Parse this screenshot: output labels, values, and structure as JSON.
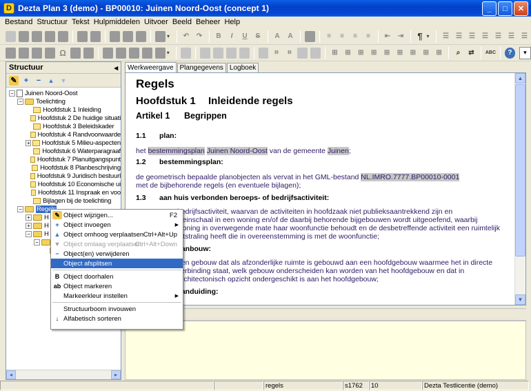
{
  "window": {
    "title": "Dezta Plan 3 (demo) - BP00010: Juinen Noord-Oost (concept 1)",
    "icon_letter": "D",
    "minimize_glyph": "_",
    "maximize_glyph": "□",
    "close_glyph": "✕"
  },
  "menubar": [
    "Bestand",
    "Structuur",
    "Tekst",
    "Hulpmiddelen",
    "Uitvoer",
    "Beeld",
    "Beheer",
    "Help"
  ],
  "toolbar": {
    "paragraph_glyph": "¶",
    "bold": "B",
    "italic": "I",
    "underline": "U",
    "strike": "S",
    "search_glyph": "🔍",
    "spell": "ABC",
    "help_glyph": "?",
    "dropdown_glyph": "▾"
  },
  "structure_panel": {
    "title": "Structuur",
    "collapse_glyph": "◂",
    "tools": {
      "edit": "✎",
      "add": "+",
      "remove": "−",
      "up": "▲",
      "down": "▼"
    },
    "tree": [
      {
        "label": "Juinen Noord-Oost",
        "level": 0,
        "expander": "−",
        "icon": "doc"
      },
      {
        "label": "Toelichting",
        "level": 1,
        "expander": "−",
        "icon": "folder"
      },
      {
        "label": "Hoofdstuk 1 Inleiding",
        "level": 2,
        "expander": "",
        "icon": "page"
      },
      {
        "label": "Hoofdstuk 2 De huidige situati",
        "level": 2,
        "expander": "",
        "icon": "page"
      },
      {
        "label": "Hoofdstuk 3 Beleidskader",
        "level": 2,
        "expander": "",
        "icon": "page"
      },
      {
        "label": "Hoofdstuk 4 Randvoorwaarde",
        "level": 2,
        "expander": "",
        "icon": "page"
      },
      {
        "label": "Hoofdstuk 5 Milieu-aspecten",
        "level": 2,
        "expander": "+",
        "icon": "page"
      },
      {
        "label": "Hoofdstuk 6 Waterparagraaf",
        "level": 2,
        "expander": "",
        "icon": "page"
      },
      {
        "label": "Hoofdstuk 7 Planuitgangspunt",
        "level": 2,
        "expander": "",
        "icon": "page"
      },
      {
        "label": "Hoofdstuk 8 Planbeschrijving",
        "level": 2,
        "expander": "",
        "icon": "page"
      },
      {
        "label": "Hoofdstuk 9 Juridisch bestuurl",
        "level": 2,
        "expander": "",
        "icon": "page"
      },
      {
        "label": "Hoofdstuk 10 Economische ui",
        "level": 2,
        "expander": "",
        "icon": "page"
      },
      {
        "label": "Hoofdstuk 11 Inspraak en voo",
        "level": 2,
        "expander": "",
        "icon": "page"
      },
      {
        "label": "Bijlagen bij de toelichting",
        "level": 2,
        "expander": "",
        "icon": "page"
      },
      {
        "label": "Regels",
        "level": 1,
        "expander": "−",
        "icon": "folder",
        "selected": true
      },
      {
        "label": "H",
        "level": 2,
        "expander": "+",
        "icon": "folder"
      },
      {
        "label": "H",
        "level": 2,
        "expander": "+",
        "icon": "folder"
      },
      {
        "label": "H",
        "level": 2,
        "expander": "−",
        "icon": "folder"
      },
      {
        "label": "",
        "level": 3,
        "expander": "−",
        "icon": "folder"
      },
      {
        "label": "",
        "level": 4,
        "expander": "",
        "icon": "page"
      }
    ],
    "scroll_left": "◂",
    "scroll_right": "▸"
  },
  "tabs": [
    "Werkweergave",
    "Plangegevens",
    "Logboek"
  ],
  "document": {
    "heading": "Regels",
    "chapter_num": "Hoofdstuk 1",
    "chapter_title": "Inleidende regels",
    "article_num": "Artikel 1",
    "article_title": "Begrippen",
    "def1_num": "1.1",
    "def1_title": "plan:",
    "def1_a": "het ",
    "def1_b": "bestemmingsplan",
    "def1_c": " ",
    "def1_d": "Juinen Noord-Oost",
    "def1_e": " van de gemeente ",
    "def1_f": "Juinen",
    "def1_g": ";",
    "def2_num": "1.2",
    "def2_title": "bestemmingsplan:",
    "def2_a": "de geometrisch bepaalde planobjecten als vervat in het GML-bestand ",
    "def2_b": "NL.IMRO.7777.BP00010-0001",
    "def2_c": "met de bijbehorende regels (en eventuele bijlagen);",
    "def3_num": "1.3",
    "def3_title": "aan huis verbonden beroeps- of bedrijfsactiviteit:",
    "def3_l1": "bedrijfsactiviteit, waarvan de activiteiten in hoofdzaak niet publieksaantrekkend zijn en",
    "def3_l2": "kleinschaal in een woning en/of de daarbij behorende bijgebouwen wordt uitgeoefend, waarbij",
    "def3_l3": "woning in overwegende mate haar woonfunctie behoudt en de desbetreffende activiteit een ruimtelijk",
    "def3_l4": "uitstraling heeft die in overeenstemming is met de woonfunctie;",
    "def4_title": "aanbouw:",
    "def4_l1": "een gebouw dat als afzonderlijke ruimte is gebouwd aan een hoofdgebouw waarmee het in directe",
    "def4_l2": "verbinding staat, welk gebouw onderscheiden kan worden van het hoofdgebouw en dat in",
    "def4_l3": "architectonisch opzicht ondergeschikt is aan het hoofdgebouw;",
    "def5_title": "aanduiding:"
  },
  "context_menu": [
    {
      "label": "Object wijzigen...",
      "shortcut": "F2",
      "icon": "✎",
      "disabled": false,
      "submenu": false
    },
    {
      "label": "Object invoegen",
      "shortcut": "",
      "icon": "+",
      "disabled": false,
      "submenu": true
    },
    {
      "label": "Object omhoog verplaatsen",
      "shortcut": "Ctrl+Alt+Up",
      "icon": "▲",
      "disabled": false,
      "submenu": false
    },
    {
      "label": "Object omlaag verplaatsen",
      "shortcut": "Ctrl+Alt+Down",
      "icon": "▼",
      "disabled": true,
      "submenu": false
    },
    {
      "label": "Object(en) verwijderen",
      "shortcut": "",
      "icon": "−",
      "disabled": false,
      "submenu": false
    },
    {
      "label": "Object afsplitsen",
      "shortcut": "",
      "icon": "",
      "disabled": false,
      "submenu": false,
      "hover": true
    },
    {
      "separator": true
    },
    {
      "label": "Object doorhalen",
      "shortcut": "",
      "icon": "B",
      "disabled": false,
      "submenu": false
    },
    {
      "label": "Object markeren",
      "shortcut": "",
      "icon": "ab",
      "disabled": false,
      "submenu": false
    },
    {
      "label": "Markeerkleur instellen",
      "shortcut": "",
      "icon": "",
      "disabled": false,
      "submenu": true
    },
    {
      "separator": true
    },
    {
      "label": "Structuurboom invouwen",
      "shortcut": "",
      "icon": "",
      "disabled": false,
      "submenu": false
    },
    {
      "label": "Alfabetisch sorteren",
      "shortcut": "",
      "icon": "↓",
      "disabled": false,
      "submenu": false
    }
  ],
  "statusbar": {
    "cell1": "",
    "cell2": "",
    "cell3": "regels",
    "cell4": "s1762",
    "cell5": "10",
    "cell6": "Dezta Testlicentie (demo)"
  },
  "colors": {
    "titlebar": "#0441C9",
    "selection": "#316AC5",
    "doc_text": "#2E1A63",
    "notes_bg": "#FFFFE1"
  }
}
